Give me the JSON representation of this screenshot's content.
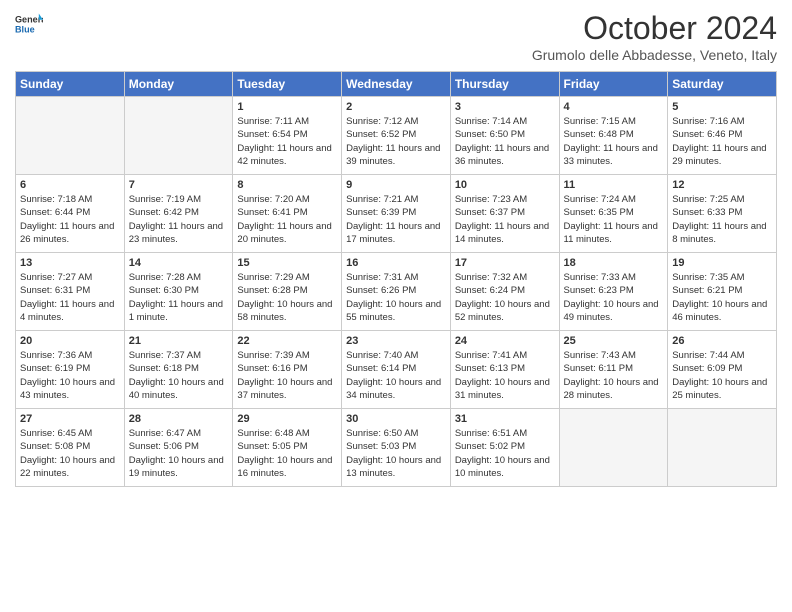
{
  "header": {
    "logo_line1": "General",
    "logo_line2": "Blue",
    "month": "October 2024",
    "location": "Grumolo delle Abbadesse, Veneto, Italy"
  },
  "days_of_week": [
    "Sunday",
    "Monday",
    "Tuesday",
    "Wednesday",
    "Thursday",
    "Friday",
    "Saturday"
  ],
  "weeks": [
    [
      {
        "day": "",
        "info": ""
      },
      {
        "day": "",
        "info": ""
      },
      {
        "day": "1",
        "info": "Sunrise: 7:11 AM\nSunset: 6:54 PM\nDaylight: 11 hours and 42 minutes."
      },
      {
        "day": "2",
        "info": "Sunrise: 7:12 AM\nSunset: 6:52 PM\nDaylight: 11 hours and 39 minutes."
      },
      {
        "day": "3",
        "info": "Sunrise: 7:14 AM\nSunset: 6:50 PM\nDaylight: 11 hours and 36 minutes."
      },
      {
        "day": "4",
        "info": "Sunrise: 7:15 AM\nSunset: 6:48 PM\nDaylight: 11 hours and 33 minutes."
      },
      {
        "day": "5",
        "info": "Sunrise: 7:16 AM\nSunset: 6:46 PM\nDaylight: 11 hours and 29 minutes."
      }
    ],
    [
      {
        "day": "6",
        "info": "Sunrise: 7:18 AM\nSunset: 6:44 PM\nDaylight: 11 hours and 26 minutes."
      },
      {
        "day": "7",
        "info": "Sunrise: 7:19 AM\nSunset: 6:42 PM\nDaylight: 11 hours and 23 minutes."
      },
      {
        "day": "8",
        "info": "Sunrise: 7:20 AM\nSunset: 6:41 PM\nDaylight: 11 hours and 20 minutes."
      },
      {
        "day": "9",
        "info": "Sunrise: 7:21 AM\nSunset: 6:39 PM\nDaylight: 11 hours and 17 minutes."
      },
      {
        "day": "10",
        "info": "Sunrise: 7:23 AM\nSunset: 6:37 PM\nDaylight: 11 hours and 14 minutes."
      },
      {
        "day": "11",
        "info": "Sunrise: 7:24 AM\nSunset: 6:35 PM\nDaylight: 11 hours and 11 minutes."
      },
      {
        "day": "12",
        "info": "Sunrise: 7:25 AM\nSunset: 6:33 PM\nDaylight: 11 hours and 8 minutes."
      }
    ],
    [
      {
        "day": "13",
        "info": "Sunrise: 7:27 AM\nSunset: 6:31 PM\nDaylight: 11 hours and 4 minutes."
      },
      {
        "day": "14",
        "info": "Sunrise: 7:28 AM\nSunset: 6:30 PM\nDaylight: 11 hours and 1 minute."
      },
      {
        "day": "15",
        "info": "Sunrise: 7:29 AM\nSunset: 6:28 PM\nDaylight: 10 hours and 58 minutes."
      },
      {
        "day": "16",
        "info": "Sunrise: 7:31 AM\nSunset: 6:26 PM\nDaylight: 10 hours and 55 minutes."
      },
      {
        "day": "17",
        "info": "Sunrise: 7:32 AM\nSunset: 6:24 PM\nDaylight: 10 hours and 52 minutes."
      },
      {
        "day": "18",
        "info": "Sunrise: 7:33 AM\nSunset: 6:23 PM\nDaylight: 10 hours and 49 minutes."
      },
      {
        "day": "19",
        "info": "Sunrise: 7:35 AM\nSunset: 6:21 PM\nDaylight: 10 hours and 46 minutes."
      }
    ],
    [
      {
        "day": "20",
        "info": "Sunrise: 7:36 AM\nSunset: 6:19 PM\nDaylight: 10 hours and 43 minutes."
      },
      {
        "day": "21",
        "info": "Sunrise: 7:37 AM\nSunset: 6:18 PM\nDaylight: 10 hours and 40 minutes."
      },
      {
        "day": "22",
        "info": "Sunrise: 7:39 AM\nSunset: 6:16 PM\nDaylight: 10 hours and 37 minutes."
      },
      {
        "day": "23",
        "info": "Sunrise: 7:40 AM\nSunset: 6:14 PM\nDaylight: 10 hours and 34 minutes."
      },
      {
        "day": "24",
        "info": "Sunrise: 7:41 AM\nSunset: 6:13 PM\nDaylight: 10 hours and 31 minutes."
      },
      {
        "day": "25",
        "info": "Sunrise: 7:43 AM\nSunset: 6:11 PM\nDaylight: 10 hours and 28 minutes."
      },
      {
        "day": "26",
        "info": "Sunrise: 7:44 AM\nSunset: 6:09 PM\nDaylight: 10 hours and 25 minutes."
      }
    ],
    [
      {
        "day": "27",
        "info": "Sunrise: 6:45 AM\nSunset: 5:08 PM\nDaylight: 10 hours and 22 minutes."
      },
      {
        "day": "28",
        "info": "Sunrise: 6:47 AM\nSunset: 5:06 PM\nDaylight: 10 hours and 19 minutes."
      },
      {
        "day": "29",
        "info": "Sunrise: 6:48 AM\nSunset: 5:05 PM\nDaylight: 10 hours and 16 minutes."
      },
      {
        "day": "30",
        "info": "Sunrise: 6:50 AM\nSunset: 5:03 PM\nDaylight: 10 hours and 13 minutes."
      },
      {
        "day": "31",
        "info": "Sunrise: 6:51 AM\nSunset: 5:02 PM\nDaylight: 10 hours and 10 minutes."
      },
      {
        "day": "",
        "info": ""
      },
      {
        "day": "",
        "info": ""
      }
    ]
  ]
}
